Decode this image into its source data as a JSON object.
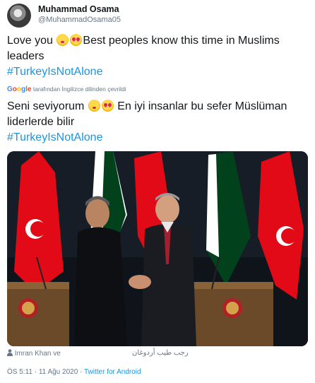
{
  "tweet": {
    "author_name": "Muhammad Osama",
    "author_handle": "@MuhammadOsama05",
    "text_en_part1": "Love you",
    "text_en_part2": "Best peoples know this time in Muslims",
    "text_en_part3": "leaders",
    "hashtag": "#TurkeyIsNotAlone",
    "translation_brand": "Google",
    "translation_note": "tarafından İngilizce dilinden çevrildi",
    "text_tr_part1": "Seni seviyorum",
    "text_tr_part2": "En iyi insanlar bu sefer Müslüman",
    "text_tr_part3": "liderlerde bilir",
    "hashtag_tr": "#TurkeyIsNotAlone",
    "photo_tags": "Imran Khan ve",
    "photo_tags_arabic": "رجب طيب أردوغان",
    "timestamp": "ÖS 5:11 · 11 Ağu 2020 ·",
    "client": "Twitter for Android"
  },
  "colors": {
    "link": "#1b95e0",
    "muted": "#657786",
    "text": "#14171a",
    "pakistan_green": "#01411c",
    "turkey_red": "#e30a17"
  },
  "icons": {
    "kiss_emoji": "face-blowing-kiss",
    "heart_eyes_emoji": "smiling-face-heart-eyes",
    "person_icon": "person-icon"
  }
}
